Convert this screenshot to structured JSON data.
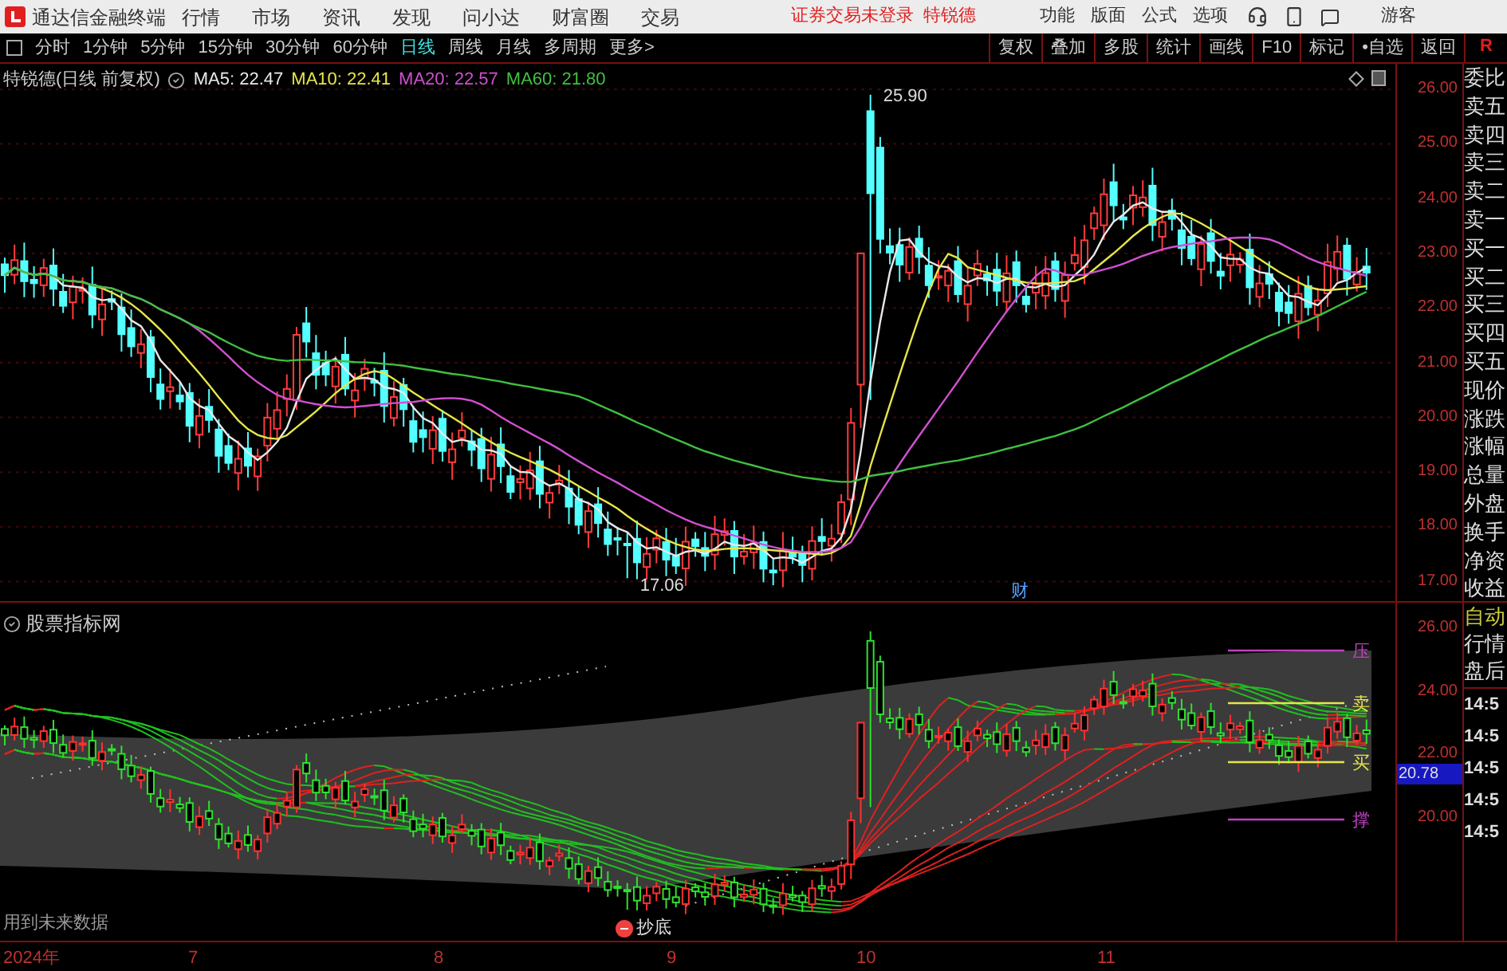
{
  "app": {
    "title": "通达信金融终端",
    "menu": [
      "行情",
      "市场",
      "资讯",
      "发现",
      "问小达",
      "财富圈",
      "交易"
    ],
    "notice": "证券交易未登录",
    "stock_link": "特锐德",
    "tools": [
      "功能",
      "版面",
      "公式",
      "选项"
    ],
    "user": "游客"
  },
  "periods": [
    {
      "label": "分时",
      "selected": false
    },
    {
      "label": "1分钟",
      "selected": false
    },
    {
      "label": "5分钟",
      "selected": false
    },
    {
      "label": "15分钟",
      "selected": false
    },
    {
      "label": "30分钟",
      "selected": false
    },
    {
      "label": "60分钟",
      "selected": false
    },
    {
      "label": "日线",
      "selected": true
    },
    {
      "label": "周线",
      "selected": false
    },
    {
      "label": "月线",
      "selected": false
    },
    {
      "label": "多周期",
      "selected": false
    },
    {
      "label": "更多>",
      "selected": false
    }
  ],
  "chart_buttons": [
    "复权",
    "叠加",
    "多股",
    "统计",
    "画线",
    "F10",
    "标记",
    "•自选",
    "返回"
  ],
  "corner": "R",
  "legend": {
    "name": "特锐德(日线 前复权)",
    "mas": [
      {
        "text": "MA5: 22.47",
        "color": "#e8e8e8"
      },
      {
        "text": "MA10: 22.41",
        "color": "#e6e64a"
      },
      {
        "text": "MA20: 22.57",
        "color": "#d050d0"
      },
      {
        "text": "MA60: 21.80",
        "color": "#40c040"
      }
    ]
  },
  "price_axis": [
    "26.00",
    "25.00",
    "24.00",
    "23.00",
    "22.00",
    "21.00",
    "20.00",
    "19.00",
    "18.00",
    "17.00"
  ],
  "annotations": {
    "high": "25.90",
    "low": "17.06",
    "marker": "财"
  },
  "indicator": {
    "title": "股票指标网",
    "axis": [
      "26.00",
      "24.00",
      "22.00",
      "20.00"
    ],
    "current": "20.78",
    "note": "用到未来数据",
    "signal": "抄底",
    "levels": [
      {
        "label": "压",
        "color": "#c040c0"
      },
      {
        "label": "卖",
        "color": "#e6e64a"
      },
      {
        "label": "买",
        "color": "#e6e64a"
      },
      {
        "label": "撑",
        "color": "#c040c0"
      }
    ]
  },
  "sidebar": {
    "quote_fields": [
      "委比",
      "卖五",
      "卖四",
      "卖三",
      "卖二",
      "卖一",
      "买一",
      "买二",
      "买三",
      "买四",
      "买五",
      "现价",
      "涨跌",
      "涨幅",
      "总量",
      "外盘",
      "换手",
      "净资",
      "收益"
    ],
    "modes": [
      "自动",
      "行情",
      "盘后"
    ],
    "times": [
      "14:5",
      "14:5",
      "14:5",
      "14:5",
      "14:5"
    ]
  },
  "time_axis": [
    "2024年",
    "7",
    "8",
    "9",
    "10",
    "11"
  ]
}
